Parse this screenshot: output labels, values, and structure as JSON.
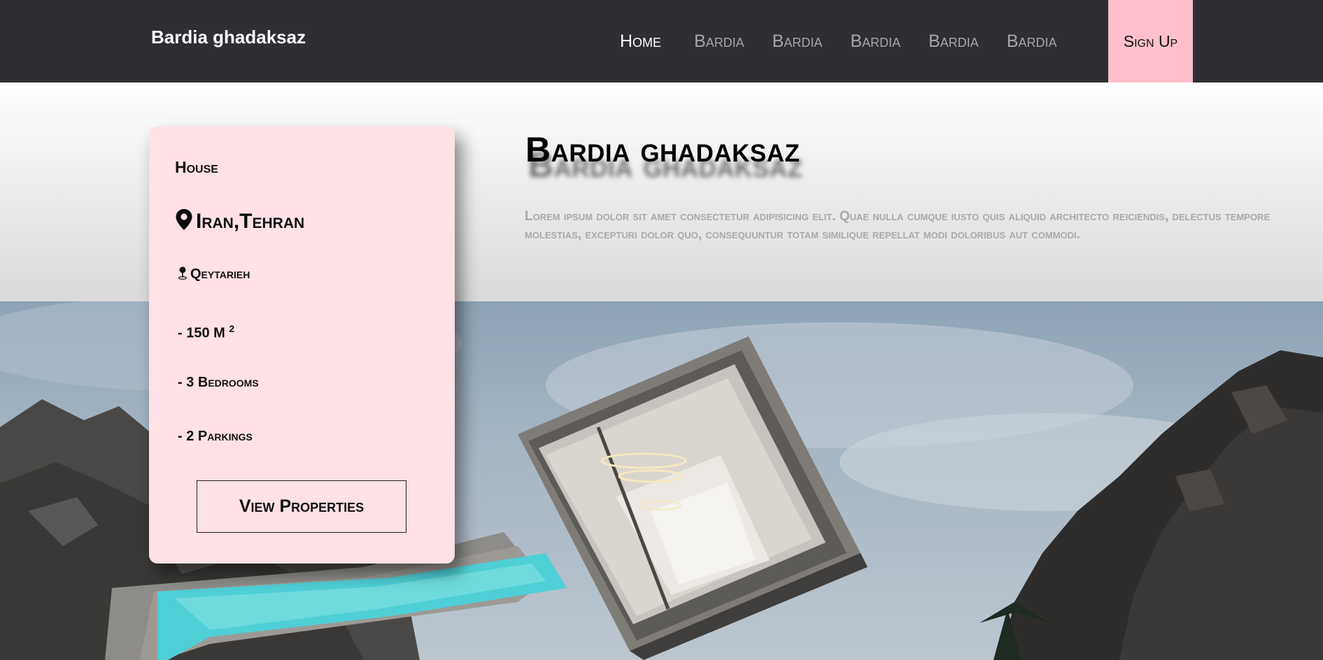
{
  "nav": {
    "brand": "Bardia ghadaksaz",
    "links": [
      {
        "label": "Home",
        "active": true
      },
      {
        "label": "Bardia",
        "active": false
      },
      {
        "label": "Bardia",
        "active": false
      },
      {
        "label": "Bardia",
        "active": false
      },
      {
        "label": "Bardia",
        "active": false
      },
      {
        "label": "Bardia",
        "active": false
      }
    ],
    "signup_label": "Sign Up"
  },
  "hero": {
    "title": "Bardia ghadaksaz",
    "text": "Lorem ipsum dolor sit amet consectetur adipisicing elit. Quae nulla cumque iusto quis aliquid architecto reiciendis, delectus tempore molestias, excepturi dolor quo, consequuntur totam similique repellat modi doloribus aut commodi."
  },
  "card": {
    "type": "House",
    "location": "Iran,Tehran",
    "area_name": "Qeytarieh",
    "size_prefix": "- 150 M",
    "size_exp": "2",
    "bedrooms": "- 3 Bedrooms",
    "parkings": "- 2 Parkings",
    "button_label": "View Properties"
  },
  "colors": {
    "navbar_bg": "#2e2f34",
    "signup_bg": "#ffc0cb",
    "card_bg": "#ffe1e6",
    "hero_text": "#a9a9a9"
  },
  "icons": {
    "location": "map-pin-icon",
    "area": "small-map-pin-icon"
  }
}
